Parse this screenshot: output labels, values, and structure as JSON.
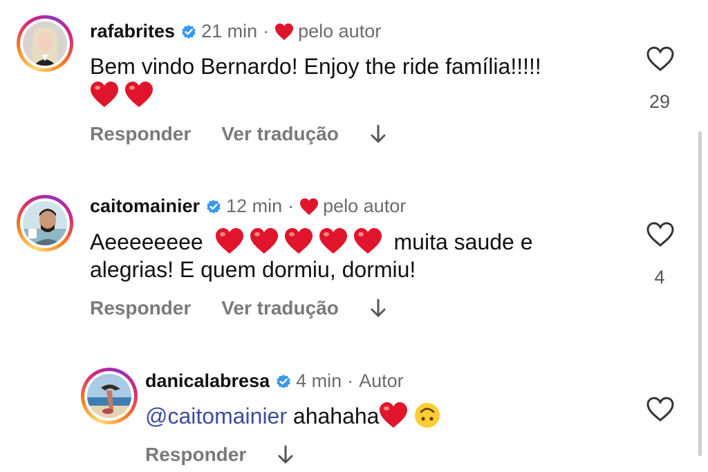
{
  "comments": [
    {
      "username": "rafabrites",
      "time": "21 min",
      "author_note": "pelo autor",
      "text_line1": "Bem vindo Bernardo! Enjoy the ride família!!!!!",
      "reply_label": "Responder",
      "translate_label": "Ver tradução",
      "likes": "29"
    },
    {
      "username": "caitomainier",
      "time": "12 min",
      "author_note": "pelo autor",
      "text_a": "Aeeeeeeee",
      "text_b": "muita saude e",
      "text_line2": "alegrias! E quem dormiu, dormiu!",
      "reply_label": "Responder",
      "translate_label": "Ver tradução",
      "likes": "4"
    },
    {
      "username": "danicalabresa",
      "time": "4 min",
      "author_note": "Autor",
      "mention": "@caitomainier",
      "text": "ahahaha",
      "reply_label": "Responder"
    }
  ],
  "colors": {
    "heart": "#e0152b",
    "verified": "#3897f0",
    "mention": "#3b4d9e"
  },
  "icons": [
    "verified-badge-icon",
    "heart-icon",
    "like-outline-icon",
    "down-arrow-icon",
    "upside-down-face-emoji"
  ]
}
